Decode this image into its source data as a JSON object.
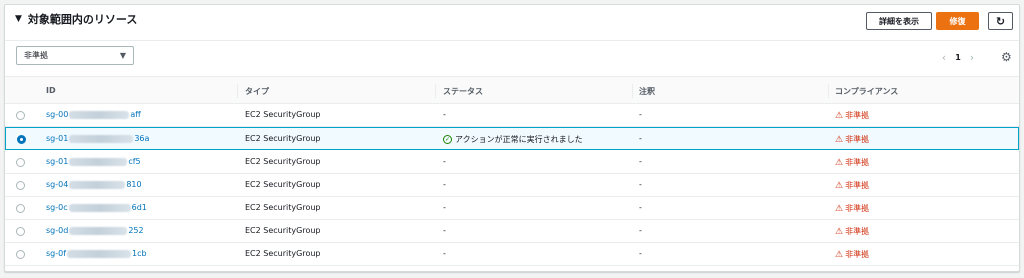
{
  "header": {
    "title": "対象範囲内のリソース",
    "detail_button": "詳細を表示",
    "fix_button": "修復"
  },
  "filter": {
    "selected": "非準拠"
  },
  "pagination": {
    "page": "1"
  },
  "columns": [
    "ID",
    "タイプ",
    "ステータス",
    "注釈",
    "コンプライアンス"
  ],
  "rows": [
    {
      "id_prefix": "sg-00",
      "id_suffix": "aff",
      "type": "EC2 SecurityGroup",
      "status": "-",
      "annotation": "-",
      "compliance": "非準拠",
      "selected": false
    },
    {
      "id_prefix": "sg-01",
      "id_suffix": "36a",
      "type": "EC2 SecurityGroup",
      "status": "アクションが正常に実行されました",
      "annotation": "-",
      "compliance": "非準拠",
      "selected": true
    },
    {
      "id_prefix": "sg-01",
      "id_suffix": "cf5",
      "type": "EC2 SecurityGroup",
      "status": "-",
      "annotation": "-",
      "compliance": "非準拠",
      "selected": false
    },
    {
      "id_prefix": "sg-04",
      "id_suffix": "810",
      "type": "EC2 SecurityGroup",
      "status": "-",
      "annotation": "-",
      "compliance": "非準拠",
      "selected": false
    },
    {
      "id_prefix": "sg-0c",
      "id_suffix": "6d1",
      "type": "EC2 SecurityGroup",
      "status": "-",
      "annotation": "-",
      "compliance": "非準拠",
      "selected": false
    },
    {
      "id_prefix": "sg-0d",
      "id_suffix": "252",
      "type": "EC2 SecurityGroup",
      "status": "-",
      "annotation": "-",
      "compliance": "非準拠",
      "selected": false
    },
    {
      "id_prefix": "sg-0f",
      "id_suffix": "1cb",
      "type": "EC2 SecurityGroup",
      "status": "-",
      "annotation": "-",
      "compliance": "非準拠",
      "selected": false
    }
  ]
}
